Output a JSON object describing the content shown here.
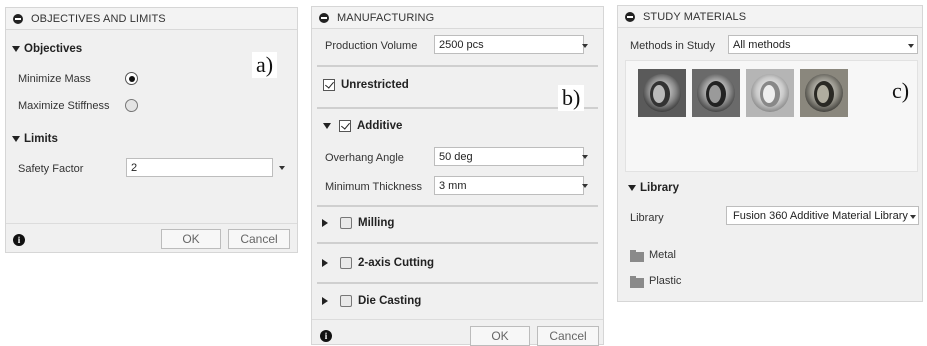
{
  "panel_a": {
    "header": "OBJECTIVES AND LIMITS",
    "objectives_title": "Objectives",
    "minimize_mass": "Minimize Mass",
    "maximize_stiffness": "Maximize Stiffness",
    "limits_title": "Limits",
    "safety_factor_label": "Safety Factor",
    "safety_factor_value": "2",
    "ok": "OK",
    "cancel": "Cancel",
    "corner": "a)"
  },
  "panel_b": {
    "header": "MANUFACTURING",
    "production_volume_label": "Production Volume",
    "production_volume_value": "2500 pcs",
    "unrestricted": "Unrestricted",
    "additive": "Additive",
    "overhang_label": "Overhang Angle",
    "overhang_value": "50 deg",
    "min_thickness_label": "Minimum Thickness",
    "min_thickness_value": "3 mm",
    "milling": "Milling",
    "two_axis": "2-axis Cutting",
    "die_casting": "Die Casting",
    "ok": "OK",
    "cancel": "Cancel",
    "corner": "b)"
  },
  "panel_c": {
    "header": "STUDY MATERIALS",
    "methods_label": "Methods in Study",
    "methods_value": "All methods",
    "library_title": "Library",
    "library_label": "Library",
    "library_value": "Fusion 360 Additive Material Library",
    "folder_metal": "Metal",
    "folder_plastic": "Plastic",
    "corner": "c)"
  }
}
